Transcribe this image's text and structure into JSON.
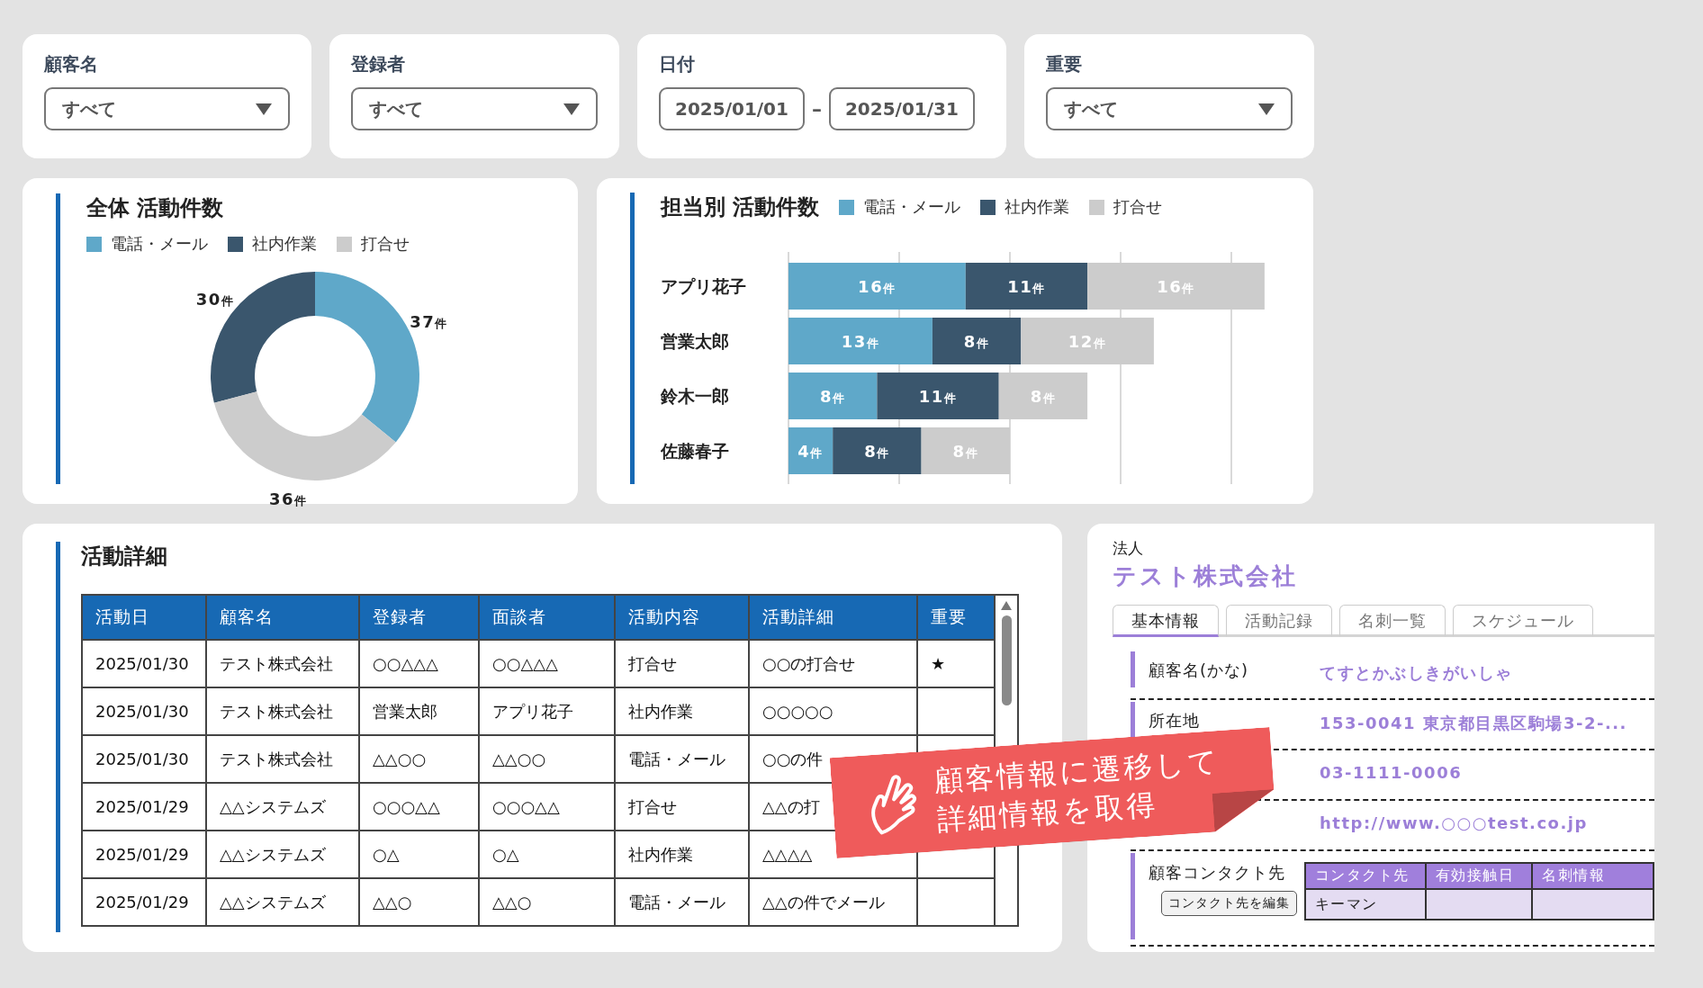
{
  "filters": [
    {
      "kind": "select",
      "label": "顧客名",
      "value": "すべて"
    },
    {
      "kind": "select",
      "label": "登録者",
      "value": "すべて"
    },
    {
      "kind": "date_range",
      "label": "日付",
      "from": "2025/01/01",
      "separator": "–",
      "to": "2025/01/31"
    },
    {
      "kind": "select",
      "label": "重要",
      "value": "すべて"
    }
  ],
  "overall_chart": {
    "title": "全体 活動件数",
    "chart_data": {
      "type": "donut",
      "categories": [
        "電話・メール",
        "社内作業",
        "打合せ"
      ],
      "colors": [
        "#5fa8c9",
        "#3a566d",
        "#cccccc"
      ],
      "values": [
        37,
        30,
        36
      ],
      "value_labels": [
        "37件",
        "30件",
        "36件"
      ]
    }
  },
  "staff_chart": {
    "title": "担当別 活動件数",
    "chart_data": {
      "type": "bar",
      "orientation": "horizontal",
      "stacked": true,
      "categories": [
        "アプリ花子",
        "営業太郎",
        "鈴木一郎",
        "佐藤春子"
      ],
      "series": [
        {
          "name": "電話・メール",
          "color": "#5fa8c9",
          "values": [
            16,
            13,
            8,
            4
          ],
          "value_labels": [
            "16件",
            "13件",
            "8件",
            "4件"
          ]
        },
        {
          "name": "社内作業",
          "color": "#3a566d",
          "values": [
            11,
            8,
            11,
            8
          ],
          "value_labels": [
            "11件",
            "8件",
            "11件",
            "8件"
          ]
        },
        {
          "name": "打合せ",
          "color": "#cccccc",
          "values": [
            16,
            12,
            8,
            8
          ],
          "value_labels": [
            "16件",
            "12件",
            "8件",
            "8件"
          ]
        }
      ]
    }
  },
  "activity_table": {
    "title": "活動詳細",
    "columns": [
      "活動日",
      "顧客名",
      "登録者",
      "面談者",
      "活動内容",
      "活動詳細",
      "重要"
    ],
    "rows": [
      [
        "2025/01/30",
        "テスト株式会社",
        "○○△△△",
        "○○△△△",
        "打合せ",
        "○○の打合せ",
        "★"
      ],
      [
        "2025/01/30",
        "テスト株式会社",
        "営業太郎",
        "アプリ花子",
        "社内作業",
        "○○○○○"
      ],
      [
        "2025/01/30",
        "テスト株式会社",
        "△△○○",
        "△△○○",
        "電話・メール",
        "○○の件"
      ],
      [
        "2025/01/29",
        "△△システムズ",
        "○○○△△",
        "○○○△△",
        "打合せ",
        "△△の打"
      ],
      [
        "2025/01/29",
        "△△システムズ",
        "○△",
        "○△",
        "社内作業",
        "△△△△"
      ],
      [
        "2025/01/29",
        "△△システムズ",
        "△△○",
        "△△○",
        "電話・メール",
        "△△の件でメール"
      ]
    ]
  },
  "callout": {
    "lines": [
      "顧客情報に遷移して",
      "詳細情報を取得"
    ]
  },
  "customer_panel": {
    "type_label": "法人",
    "company": "テスト株式会社",
    "tabs": [
      {
        "label": "基本情報",
        "selected": true
      },
      {
        "label": "活動記録",
        "selected": false
      },
      {
        "label": "名刺一覧",
        "selected": false
      },
      {
        "label": "スケジュール",
        "selected": false
      }
    ],
    "fields": [
      {
        "label": "顧客名(かな)",
        "value": "てすとかぶしきがいしゃ"
      },
      {
        "label": "所在地",
        "value": "153-0041 東京都目黒区駒場3-2-..."
      },
      {
        "value": "03-1111-0006"
      },
      {
        "value": "http://www.○○○test.co.jp"
      }
    ],
    "contacts": {
      "label": "顧客コンタクト先",
      "edit_button": "コンタクト先を編集",
      "columns": [
        "コンタクト先",
        "有効接触日",
        "名刺情報"
      ],
      "rows": [
        [
          "キーマン"
        ]
      ]
    }
  }
}
